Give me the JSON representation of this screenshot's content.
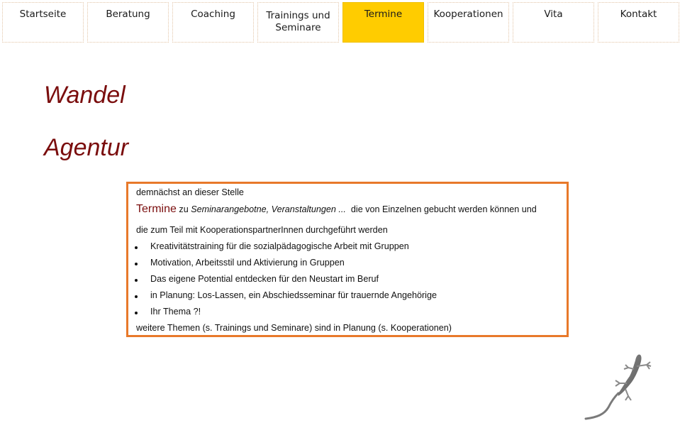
{
  "nav": {
    "items": [
      {
        "label": "Startseite",
        "active": false
      },
      {
        "label": "Beratung",
        "active": false
      },
      {
        "label": "Coaching",
        "active": false
      },
      {
        "label_line1": "Trainings und",
        "label_line2": "Seminare",
        "active": false
      },
      {
        "label": "Termine",
        "active": true
      },
      {
        "label": "Kooperationen",
        "active": false
      },
      {
        "label": "Vita",
        "active": false
      },
      {
        "label": "Kontakt",
        "active": false
      }
    ],
    "active_color": "#ffcc00"
  },
  "logo": {
    "line1": "Wandel",
    "line2": "Agentur",
    "color": "#7a0d0d"
  },
  "content": {
    "border_color": "#e8792a",
    "intro": "demnächst an dieser Stelle",
    "termine_word": "Termine",
    "zu": " zu ",
    "italic_part": "Seminarangebotne, Veranstaltungen ...",
    "rest_line": "  die von Einzelnen gebucht werden können und",
    "line3": "die zum Teil mit KooperationspartnerInnen durchgeführt werden",
    "bullets": [
      "Kreativitätstraining für die sozialpädagogische Arbeit mit Gruppen",
      "Motivation, Arbeitsstil und Aktivierung in Gruppen",
      "Das eigene Potential entdecken für den Neustart im Beruf",
      "in Planung: Los-Lassen, ein Abschiedsseminar für trauernde Angehörige",
      "Ihr Thema ?!"
    ],
    "footer": "weitere Themen (s. Trainings und Seminare) sind in Planung (s. Kooperationen)"
  },
  "image": {
    "icon": "gecko-icon"
  }
}
